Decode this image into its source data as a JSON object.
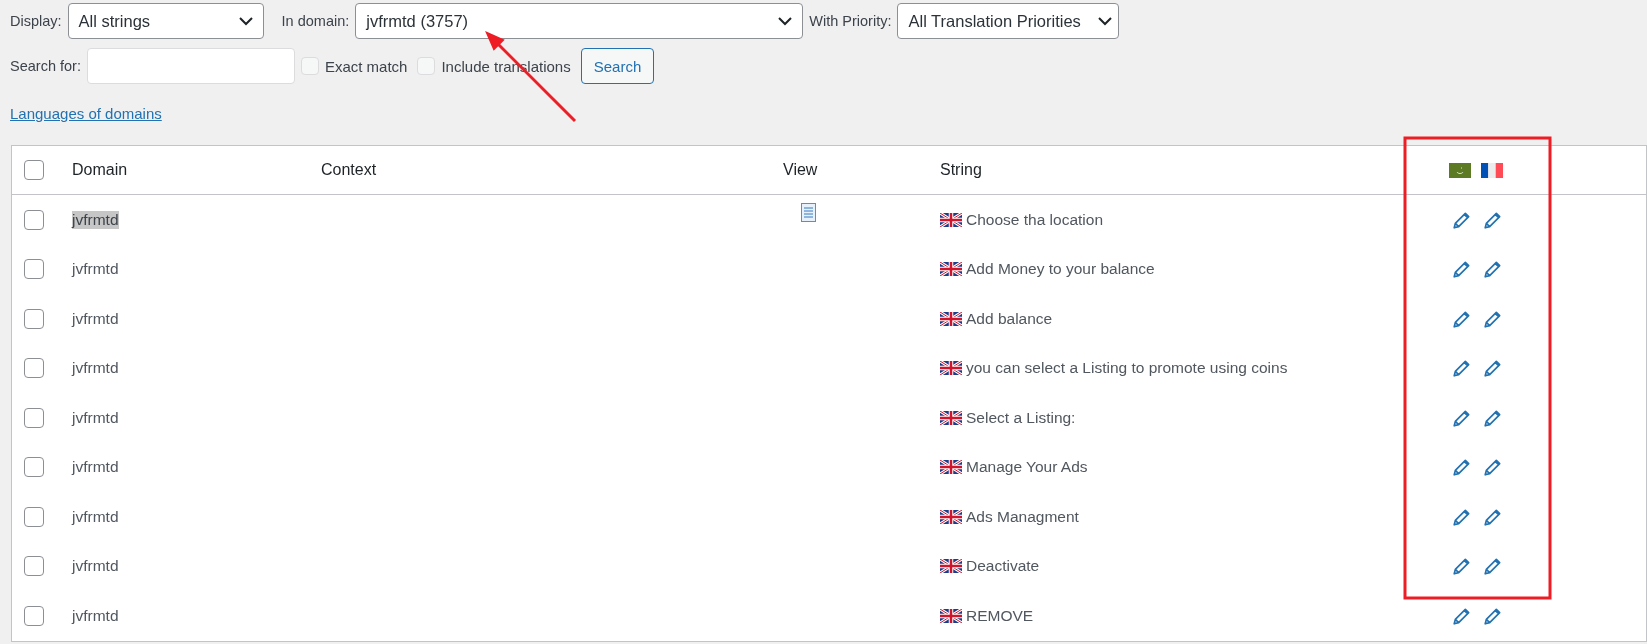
{
  "filters": {
    "display_label": "Display:",
    "display_value": "All strings",
    "domain_label": "In domain:",
    "domain_value": "jvfrmtd (3757)",
    "priority_label": "With Priority:",
    "priority_value": "All Translation Priorities"
  },
  "search": {
    "label": "Search for:",
    "exact_match": {
      "label": "Exact match",
      "checked": false
    },
    "include_translations": {
      "label": "Include translations",
      "checked": false
    },
    "button": "Search"
  },
  "languages_link": "Languages of domains",
  "table": {
    "select_all_checked": false,
    "columns": [
      "Domain",
      "Context",
      "View",
      "String"
    ],
    "rows": [
      {
        "domain": "jvfrmtd",
        "highlighted": true,
        "view_icon": true,
        "string": "Choose tha location",
        "checked": false
      },
      {
        "domain": "jvfrmtd",
        "highlighted": false,
        "view_icon": false,
        "string": "Add Money to your balance",
        "checked": false
      },
      {
        "domain": "jvfrmtd",
        "highlighted": false,
        "view_icon": false,
        "string": "Add balance",
        "checked": false
      },
      {
        "domain": "jvfrmtd",
        "highlighted": false,
        "view_icon": false,
        "string": "you can select a Listing to promote using coins",
        "checked": false
      },
      {
        "domain": "jvfrmtd",
        "highlighted": false,
        "view_icon": false,
        "string": "Select a Listing:",
        "checked": false
      },
      {
        "domain": "jvfrmtd",
        "highlighted": false,
        "view_icon": false,
        "string": "Manage Your Ads",
        "checked": false
      },
      {
        "domain": "jvfrmtd",
        "highlighted": false,
        "view_icon": false,
        "string": "Ads Managment",
        "checked": false
      },
      {
        "domain": "jvfrmtd",
        "highlighted": false,
        "view_icon": false,
        "string": "Deactivate",
        "checked": false
      },
      {
        "domain": "jvfrmtd",
        "highlighted": false,
        "view_icon": false,
        "string": "REMOVE",
        "checked": false
      }
    ]
  }
}
